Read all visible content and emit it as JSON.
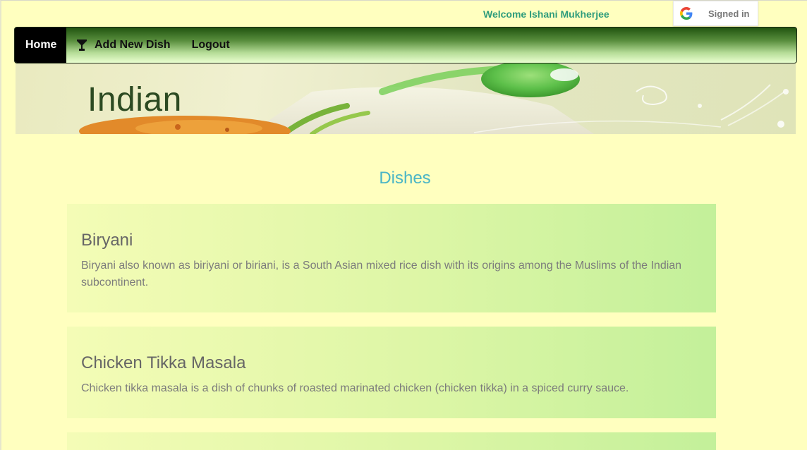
{
  "header": {
    "welcome_text": "Welcome Ishani Mukherjee",
    "google_button_label": "Signed in",
    "google_icon": "google-g-icon"
  },
  "nav": {
    "items": [
      {
        "label": "Home",
        "active": true
      },
      {
        "label": "Add New Dish",
        "icon": "cocktail-glass-icon"
      },
      {
        "label": "Logout"
      }
    ]
  },
  "banner": {
    "title": "Indian"
  },
  "main": {
    "section_title": "Dishes",
    "dishes": [
      {
        "name": "Biryani",
        "description": "Biryani also known as biriyani or biriani, is a South Asian mixed rice dish with its origins among the Muslims of the Indian subcontinent."
      },
      {
        "name": "Chicken Tikka Masala",
        "description": "Chicken tikka masala is a dish of chunks of roasted marinated chicken (chicken tikka) in a spiced curry sauce."
      }
    ]
  },
  "colors": {
    "page_background": "#ffffbf",
    "welcome_text": "#2e9c7c",
    "section_title": "#49b5c6",
    "navbar_gradient_top": "#215410",
    "navbar_gradient_bottom": "#eaffd0",
    "card_gradient_left": "#f4fcb6",
    "card_gradient_right": "#c3f09a"
  }
}
